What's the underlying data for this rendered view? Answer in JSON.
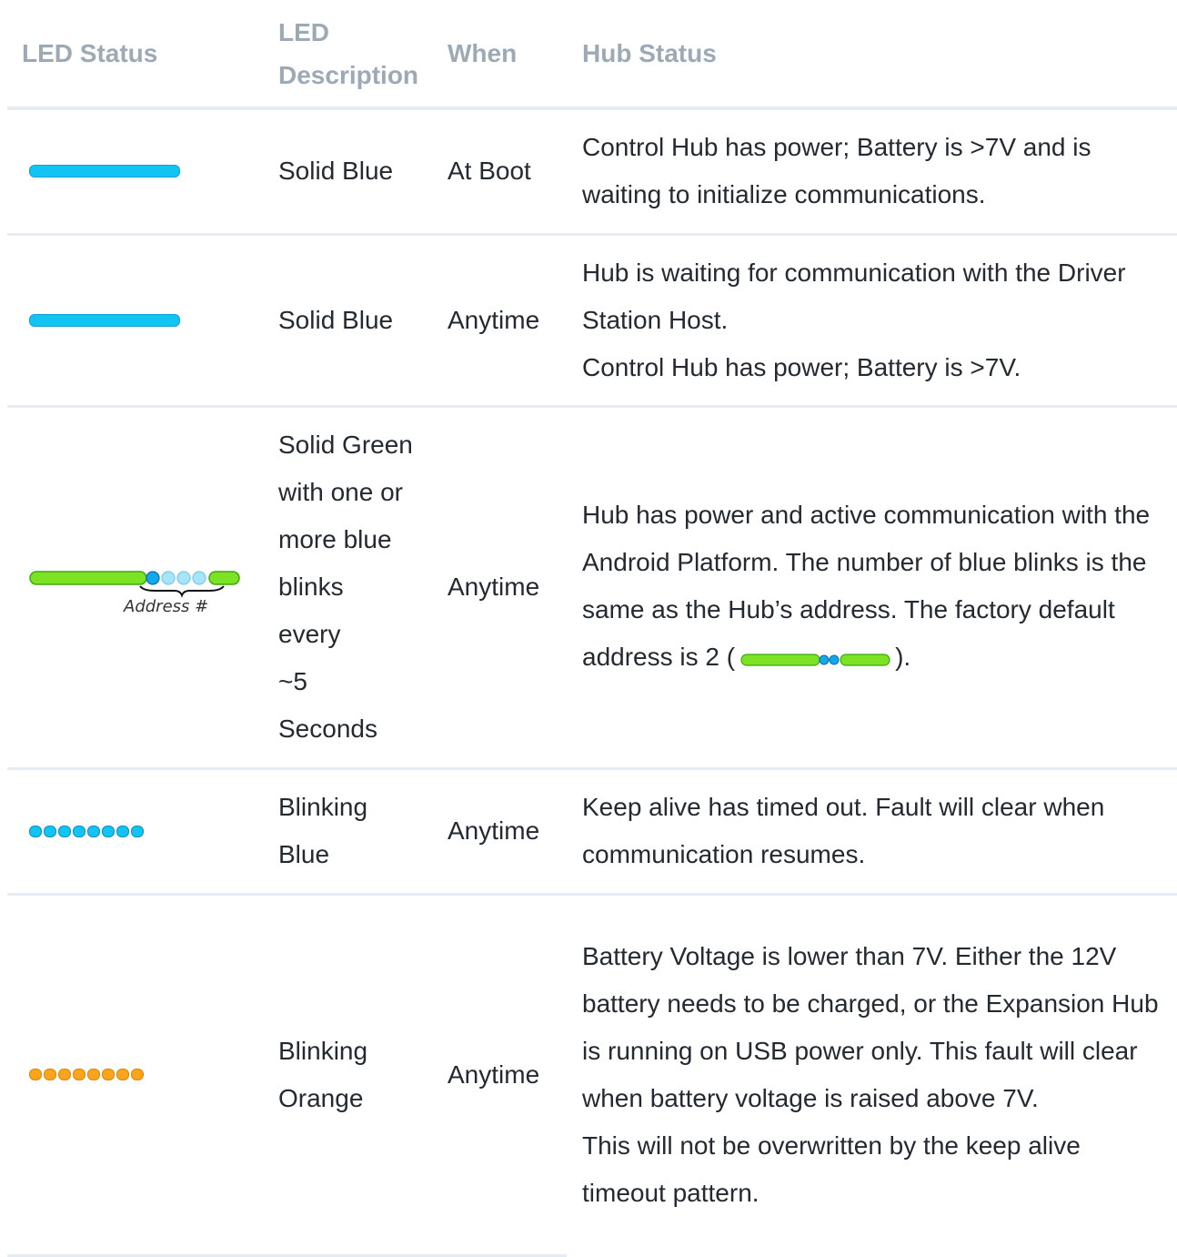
{
  "headers": {
    "led_status": "LED Status",
    "led_description_line1": "LED",
    "led_description_line2": "Description",
    "when": "When",
    "hub_status": "Hub Status"
  },
  "rows": [
    {
      "led_icon": "solid-blue-led-bar",
      "led_color": "#12c3f4",
      "description": "Solid Blue",
      "when": "At Boot",
      "hub_status": [
        "Control Hub has power; Battery is >7V and is waiting to initialize communications."
      ]
    },
    {
      "led_icon": "solid-blue-led-bar",
      "led_color": "#12c3f4",
      "description": "Solid Blue",
      "when": "Anytime",
      "hub_status": [
        "Hub is waiting for communication with the Driver Station Host.",
        "Control Hub has power; Battery is >7V."
      ]
    },
    {
      "led_icon": "green-with-blue-blinks-led",
      "led_color": "#7be324",
      "led_caption": "Address #",
      "description_lines": [
        "Solid Green",
        "with one or",
        "more blue",
        "blinks",
        "every",
        "~5",
        "Seconds"
      ],
      "when": "Anytime",
      "hub_status_prefix": "Hub has power and active communication with the Android Platform. The number of blue blinks is the same as the Hub’s address. The factory default address is 2 (",
      "hub_status_suffix": ")."
    },
    {
      "led_icon": "blinking-blue-led-dots",
      "led_color": "#12c3f4",
      "description_lines": [
        "Blinking",
        "Blue"
      ],
      "when": "Anytime",
      "hub_status": [
        "Keep alive has timed out. Fault will clear when communication resumes."
      ]
    },
    {
      "led_icon": "blinking-orange-led-dots",
      "led_color": "#f9a41a",
      "description_lines": [
        "Blinking",
        "Orange"
      ],
      "when": "Anytime",
      "hub_status": [
        "Battery Voltage is lower than 7V. Either the 12V battery needs to be charged, or the Expansion Hub is running on USB power only. This fault will clear when battery voltage is raised above 7V.",
        "This will not be overwritten by the keep alive timeout pattern."
      ]
    }
  ]
}
